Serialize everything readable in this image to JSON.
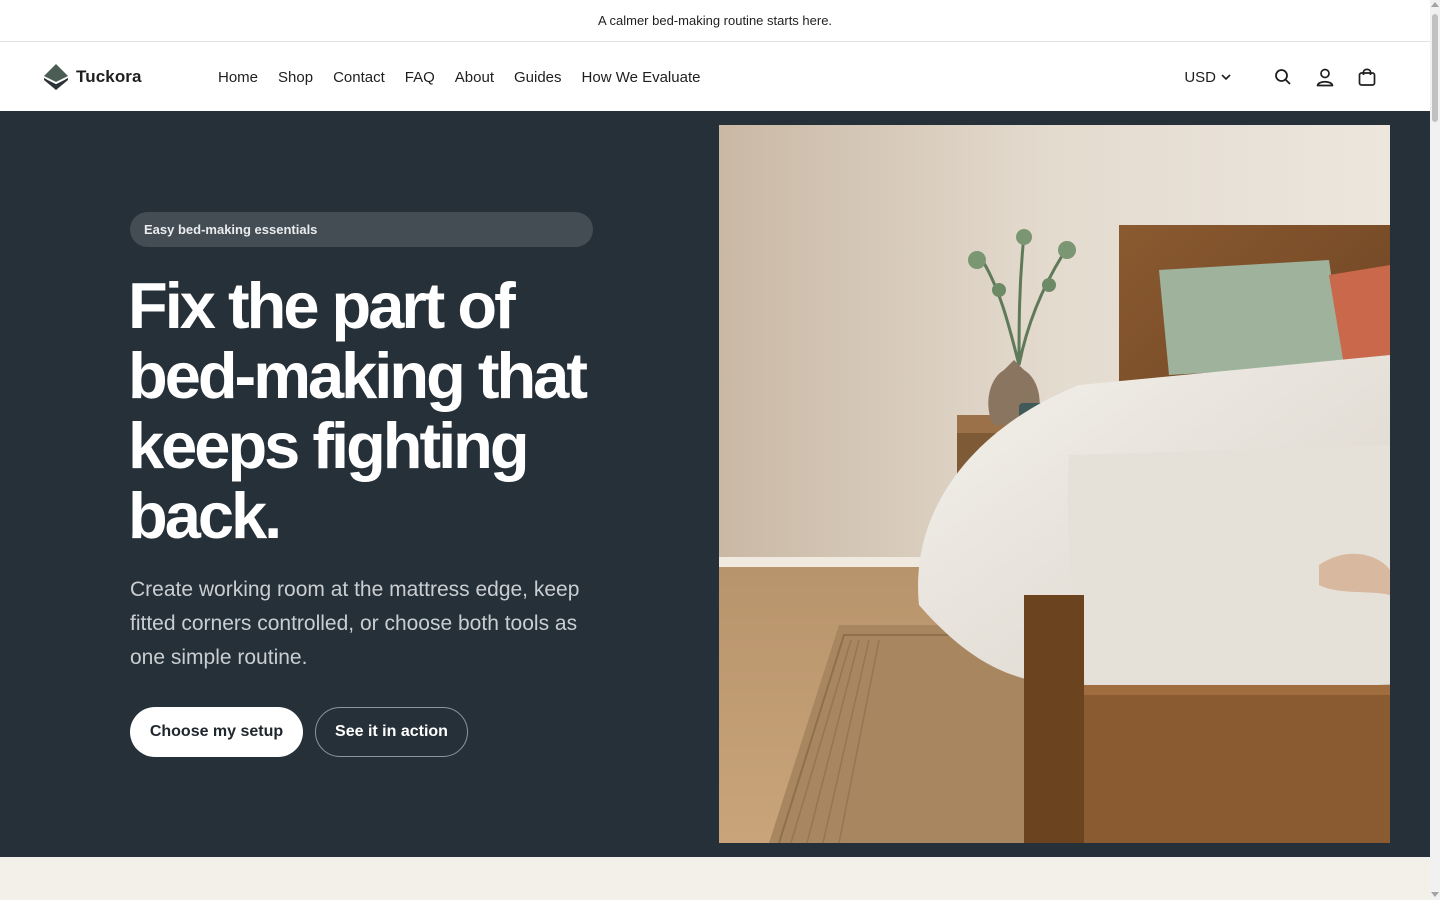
{
  "announcement": {
    "text": "A calmer bed-making routine starts here."
  },
  "header": {
    "brand": "Tuckora",
    "nav": [
      {
        "label": "Home"
      },
      {
        "label": "Shop"
      },
      {
        "label": "Contact"
      },
      {
        "label": "FAQ"
      },
      {
        "label": "About"
      },
      {
        "label": "Guides"
      },
      {
        "label": "How We Evaluate"
      }
    ],
    "currency": "USD",
    "icons": [
      "search-icon",
      "account-icon",
      "cart-icon"
    ]
  },
  "hero": {
    "badge": "Easy bed-making essentials",
    "title": "Fix the part of bed-making that keeps fighting back.",
    "subtitle": "Create working room at the mattress edge, keep fitted corners controlled, or choose both tools as one simple routine.",
    "primary_cta": "Choose my setup",
    "secondary_cta": "See it in action"
  },
  "colors": {
    "hero_background": "#263038",
    "badge_background": "#444d54",
    "next_section_background": "#f3efe9"
  }
}
